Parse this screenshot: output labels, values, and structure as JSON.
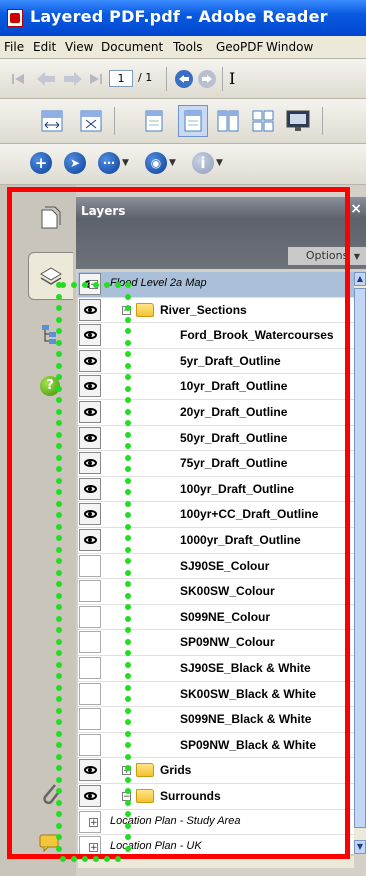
{
  "window": {
    "title": "Layered PDF.pdf - Adobe Reader"
  },
  "menu": [
    "File",
    "Edit",
    "View",
    "Document",
    "Tools",
    "GeoPDF",
    "Window"
  ],
  "toolbar": {
    "page_current": "1",
    "page_total": "/ 1",
    "icons_row1": [
      "first-page-icon",
      "prev-page-icon",
      "next-page-icon",
      "last-page-icon",
      "back-icon",
      "forward-icon",
      "text-select-icon"
    ],
    "icons_row2": [
      "fit-width-icon",
      "fit-page-icon",
      "single-page-icon",
      "single-page-continuous-icon",
      "two-page-icon",
      "two-page-continuous-icon",
      "full-screen-icon"
    ],
    "icons_row3": [
      "geo-add-icon",
      "geo-navigate-icon",
      "geo-more-icon",
      "geo-gps-icon",
      "geo-info-icon"
    ]
  },
  "panel": {
    "title": "Layers",
    "close": "×",
    "options": "Options"
  },
  "side_tabs": [
    "pages-tab",
    "layers-tab",
    "structure-tab",
    "help-tab",
    "attachments-tab",
    "comments-tab"
  ],
  "layers": [
    {
      "label": "Flood Level 2a Map",
      "visible": true,
      "level": 0,
      "expander": "minus",
      "folder": false,
      "italic": true,
      "selected": true
    },
    {
      "label": "River_Sections",
      "visible": true,
      "level": 1,
      "expander": "minus",
      "folder": true
    },
    {
      "label": "Ford_Brook_Watercourses",
      "visible": true,
      "level": 2
    },
    {
      "label": "5yr_Draft_Outline",
      "visible": true,
      "level": 2
    },
    {
      "label": "10yr_Draft_Outline",
      "visible": true,
      "level": 2
    },
    {
      "label": "20yr_Draft_Outline",
      "visible": true,
      "level": 2
    },
    {
      "label": "50yr_Draft_Outline",
      "visible": true,
      "level": 2
    },
    {
      "label": "75yr_Draft_Outline",
      "visible": true,
      "level": 2
    },
    {
      "label": "100yr_Draft_Outline",
      "visible": true,
      "level": 2
    },
    {
      "label": "100yr+CC_Draft_Outline",
      "visible": true,
      "level": 2
    },
    {
      "label": "1000yr_Draft_Outline",
      "visible": true,
      "level": 2
    },
    {
      "label": "SJ90SE_Colour",
      "visible": false,
      "level": 2
    },
    {
      "label": "SK00SW_Colour",
      "visible": false,
      "level": 2
    },
    {
      "label": "S099NE_Colour",
      "visible": false,
      "level": 2
    },
    {
      "label": "SP09NW_Colour",
      "visible": false,
      "level": 2
    },
    {
      "label": "SJ90SE_Black & White",
      "visible": false,
      "level": 2
    },
    {
      "label": "SK00SW_Black & White",
      "visible": false,
      "level": 2
    },
    {
      "label": "S099NE_Black & White",
      "visible": false,
      "level": 2
    },
    {
      "label": "SP09NW_Black & White",
      "visible": false,
      "level": 2
    },
    {
      "label": "Grids",
      "visible": true,
      "level": 1,
      "expander": "plus",
      "folder": true
    },
    {
      "label": "Surrounds",
      "visible": true,
      "level": 1,
      "expander": "minus",
      "folder": true
    },
    {
      "label": "Location Plan - Study Area",
      "visible": false,
      "level": 0,
      "expander": "plus",
      "italic": true
    },
    {
      "label": "Location Plan - UK",
      "visible": false,
      "level": 0,
      "expander": "plus",
      "italic": true
    }
  ],
  "colors": {
    "highlight_box": "#ff0000",
    "dotted_lines": "#22dd22",
    "selection": "#a9c0d8",
    "titlebar": "#0a5ae0"
  }
}
